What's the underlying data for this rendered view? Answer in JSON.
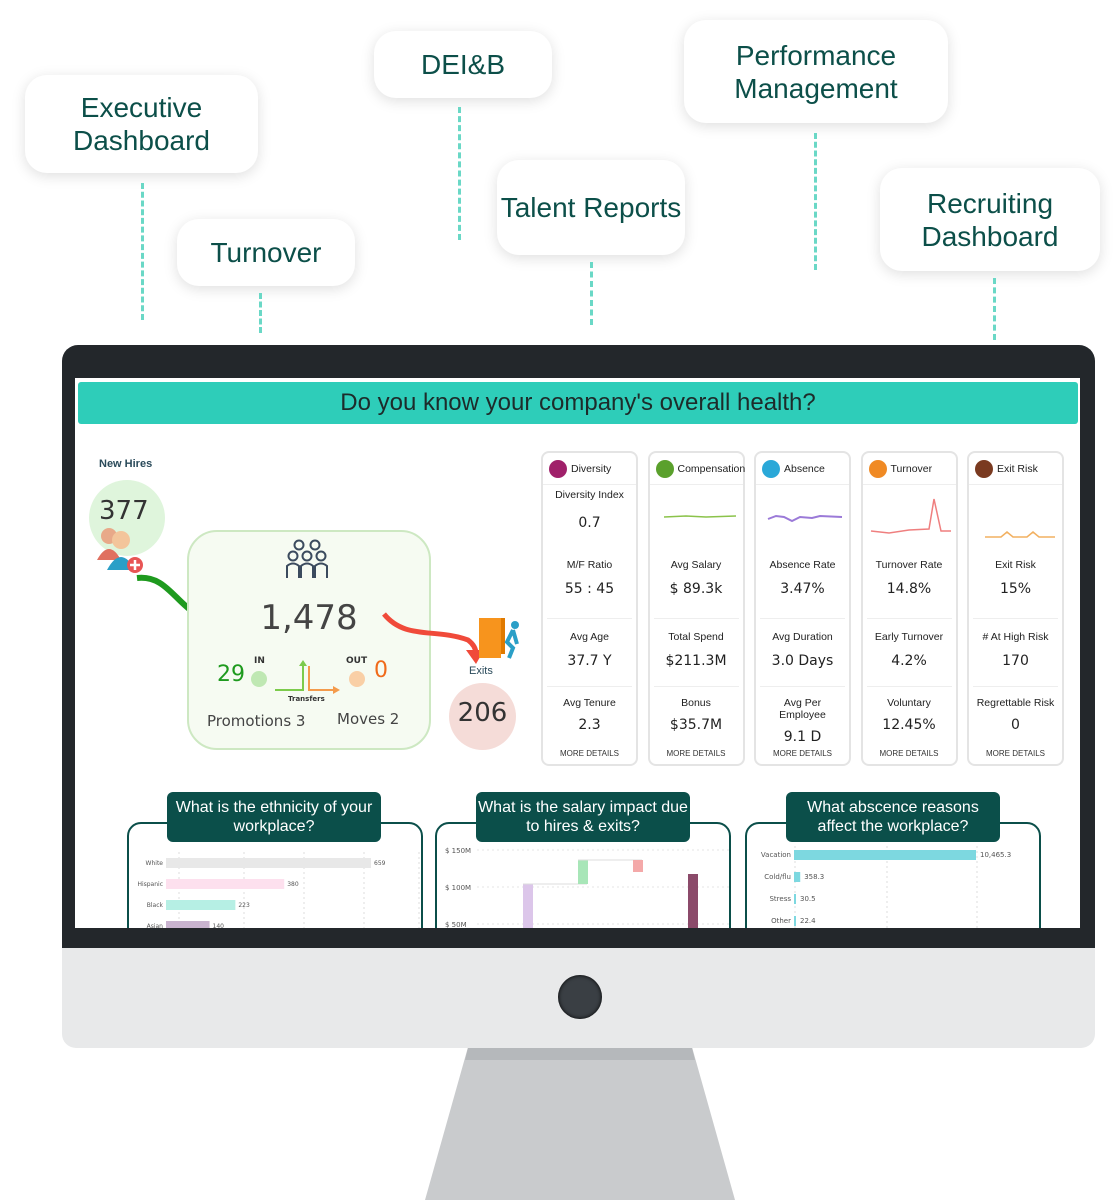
{
  "callouts": [
    "Executive Dashboard",
    "Turnover",
    "DEI&B",
    "Talent Reports",
    "Performance Management",
    "Recruiting Dashboard"
  ],
  "banner": "Do you know your company's overall health?",
  "flow": {
    "new_hires_label": "New Hires",
    "new_hires": "377",
    "headcount": "1,478",
    "in_label": "IN",
    "in_value": "29",
    "out_label": "OUT",
    "out_value": "0",
    "transfers_label": "Transfers",
    "promotions": "Promotions 3",
    "moves": "Moves 2",
    "exits_label": "Exits",
    "exits": "206"
  },
  "cards": [
    {
      "title": "Diversity",
      "icon": "diversity-icon",
      "color": "#a0206a",
      "m1_label": "Diversity Index",
      "m1": "0.7",
      "m2_label": "M/F Ratio",
      "m2": "55 : 45",
      "m3_label": "Avg Age",
      "m3": "37.7 Y",
      "m4_label": "Avg Tenure",
      "m4": "2.3",
      "more": "MORE DETAILS"
    },
    {
      "title": "Compensation",
      "icon": "money-bag-icon",
      "color": "#5aa02c",
      "m1_label": "",
      "m1": "",
      "m2_label": "Avg Salary",
      "m2": "$ 89.3k",
      "m3_label": "Total Spend",
      "m3": "$211.3M",
      "m4_label": "Bonus",
      "m4": "$35.7M",
      "more": "MORE DETAILS"
    },
    {
      "title": "Absence",
      "icon": "clock-person-icon",
      "color": "#2aa8d8",
      "m1_label": "",
      "m1": "",
      "m2_label": "Absence Rate",
      "m2": "3.47%",
      "m3_label": "Avg Duration",
      "m3": "3.0 Days",
      "m4_label": "Avg Per Employee",
      "m4": "9.1 D",
      "more": "MORE DETAILS"
    },
    {
      "title": "Turnover",
      "icon": "turnover-icon",
      "color": "#f08a24",
      "m1_label": "",
      "m1": "",
      "m2_label": "Turnover Rate",
      "m2": "14.8%",
      "m3_label": "Early Turnover",
      "m3": "4.2%",
      "m4_label": "Voluntary",
      "m4": "12.45%",
      "more": "MORE DETAILS"
    },
    {
      "title": "Exit Risk",
      "icon": "exit-door-icon",
      "color": "#7a3a20",
      "m1_label": "",
      "m1": "",
      "m2_label": "Exit Risk",
      "m2": "15%",
      "m3_label": "# At High Risk",
      "m3": "170",
      "m4_label": "Regrettable Risk",
      "m4": "0",
      "more": "MORE DETAILS"
    }
  ],
  "panels": [
    {
      "title": "What is the ethnicity of your workplace?"
    },
    {
      "title": "What is the salary impact due to hires & exits?"
    },
    {
      "title": "What abscence reasons affect the workplace?"
    }
  ],
  "chart_data": [
    {
      "type": "bar",
      "categories": [
        "White",
        "Hispanic",
        "Black",
        "Asian"
      ],
      "values": [
        659,
        380,
        223,
        140
      ],
      "labels": [
        "659",
        "380",
        "223",
        "140"
      ],
      "colors": [
        "#e8e8e8",
        "#fde0ee",
        "#b6efe4",
        "#c9b3cf"
      ]
    },
    {
      "type": "bar",
      "yticks": [
        "$ 150M",
        "$ 100M",
        "$ 50M"
      ],
      "ylim": [
        50,
        150
      ]
    },
    {
      "type": "bar",
      "categories": [
        "Vacation",
        "Cold/flu",
        "Stress",
        "Other"
      ],
      "values": [
        10465.3,
        358.3,
        30.5,
        22.4
      ],
      "labels": [
        "10,465.3",
        "358.3",
        "30.5",
        "22.4"
      ],
      "color": "#7dd8e0"
    }
  ]
}
